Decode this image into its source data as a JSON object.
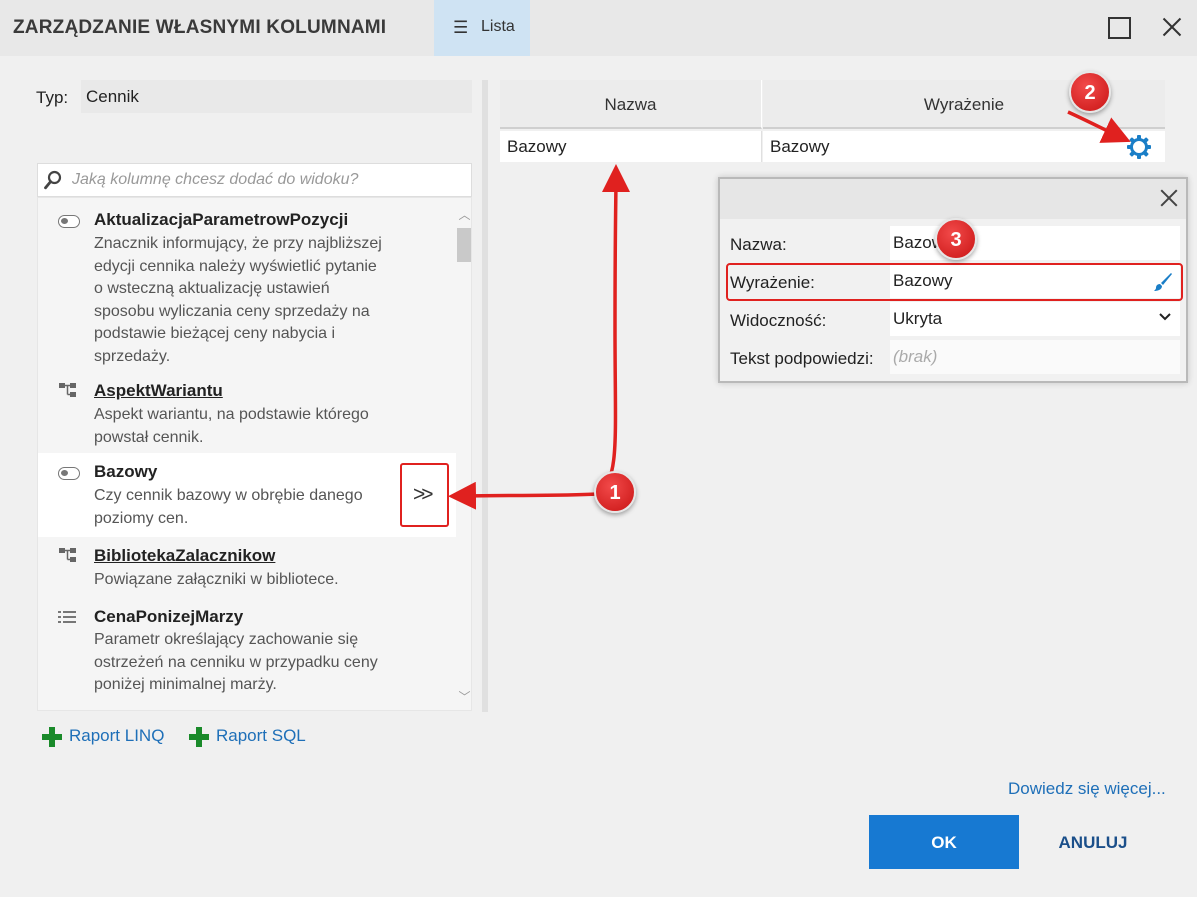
{
  "window": {
    "title": "ZARZĄDZANIE WŁASNYMI KOLUMNAMI",
    "view_tab": "Lista",
    "view_tab_icon": "hamburger-icon"
  },
  "type_field": {
    "label": "Typ:",
    "value": "Cennik"
  },
  "search": {
    "placeholder": "Jaką kolumnę chcesz dodać do widoku?"
  },
  "columns_list": [
    {
      "name": "AktualizacjaParametrowPozycji",
      "icon": "toggle-icon",
      "link": false,
      "description": [
        "Znacznik informujący, że przy najbliższej",
        "edycji cennika należy wyświetlić pytanie",
        "o wsteczną aktualizację ustawień",
        "sposobu wyliczania ceny sprzedaży na",
        "podstawie bieżącej ceny nabycia i",
        "sprzedaży."
      ]
    },
    {
      "name": "AspektWariantu",
      "icon": "tree-icon",
      "link": true,
      "description": [
        "Aspekt wariantu, na podstawie którego",
        "powstał cennik."
      ]
    },
    {
      "name": "Bazowy",
      "icon": "toggle-icon",
      "link": false,
      "selected": true,
      "description": [
        "Czy cennik bazowy w obrębie danego",
        "poziomy cen."
      ]
    },
    {
      "name": "BibliotekaZalacznikow",
      "icon": "tree-icon",
      "link": true,
      "description": [
        "Powiązane załączniki w bibliotece."
      ]
    },
    {
      "name": "CenaPonizejMarzy",
      "icon": "list-icon",
      "link": false,
      "description": [
        "Parametr określający zachowanie się",
        "ostrzeżeń na cenniku w przypadku ceny",
        "poniżej minimalnej marży."
      ]
    }
  ],
  "add_button_label": ">>",
  "report_links": {
    "linq": "Raport LINQ",
    "sql": "Raport SQL"
  },
  "grid": {
    "headers": [
      "Nazwa",
      "Wyrażenie"
    ],
    "row": {
      "name": "Bazowy",
      "expression": "Bazowy"
    }
  },
  "popup": {
    "fields": [
      {
        "label": "Nazwa:",
        "value": "Bazowy"
      },
      {
        "label": "Wyrażenie:",
        "value": "Bazowy"
      },
      {
        "label": "Widoczność:",
        "value": "Ukryta"
      },
      {
        "label": "Tekst podpowiedzi:",
        "placeholder": "(brak)"
      }
    ]
  },
  "footer": {
    "learn_more": "Dowiedz się więcej...",
    "ok": "OK",
    "cancel": "ANULUJ"
  },
  "annotations": {
    "badges": [
      "1",
      "2",
      "3"
    ],
    "color": "#e0211f"
  },
  "colors": {
    "accent": "#1779d2",
    "link": "#1e6fb8",
    "plus": "#1a8a2a",
    "tab": "#cfe3f3",
    "gear": "#1a7ec7"
  }
}
